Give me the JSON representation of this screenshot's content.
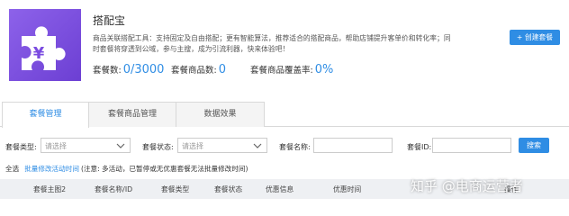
{
  "app": {
    "title": "搭配宝",
    "description": "商品关联搭配工具：支持固定及自由搭配；更有智能算法，推荐适合的搭配商品，帮助店铺提升客单价和转化率；同时套餐将穿透到公域，参与主搜，成为引流利器，快来体验吧！",
    "create_button": "+ 创建套餐",
    "logo_icon": "puzzle-piece-yen-icon",
    "stats": [
      {
        "label": "套餐数:",
        "value": "0/3000"
      },
      {
        "label": "套餐商品数:",
        "value": "0"
      },
      {
        "label": "套餐商品覆盖率:",
        "value": "0%"
      }
    ]
  },
  "tabs": [
    {
      "label": "套餐管理",
      "active": true
    },
    {
      "label": "套餐商品管理",
      "active": false
    },
    {
      "label": "数据效果",
      "active": false
    }
  ],
  "filters": {
    "type_label": "套餐类型:",
    "type_placeholder": "请选择",
    "status_label": "套餐状态:",
    "status_placeholder": "请选择",
    "name_label": "套餐名称:",
    "name_value": "",
    "id_label": "套餐ID:",
    "id_value": "",
    "search_button": "搜索"
  },
  "bulk": {
    "select_all": "全选",
    "modify_link": "批量修改活动时间",
    "note": "(注意: 多活动，已暂停或无优惠套餐无法批量修改时间)"
  },
  "table": {
    "headers": [
      "套餐主图2",
      "套餐名称/ID",
      "套餐类型",
      "套餐状态",
      "优惠信息",
      "优惠时间",
      "操作"
    ]
  },
  "watermark": "知乎 @电商运营者",
  "colors": {
    "accent": "#2f8de4",
    "logo_bg": "#7a4be0"
  }
}
